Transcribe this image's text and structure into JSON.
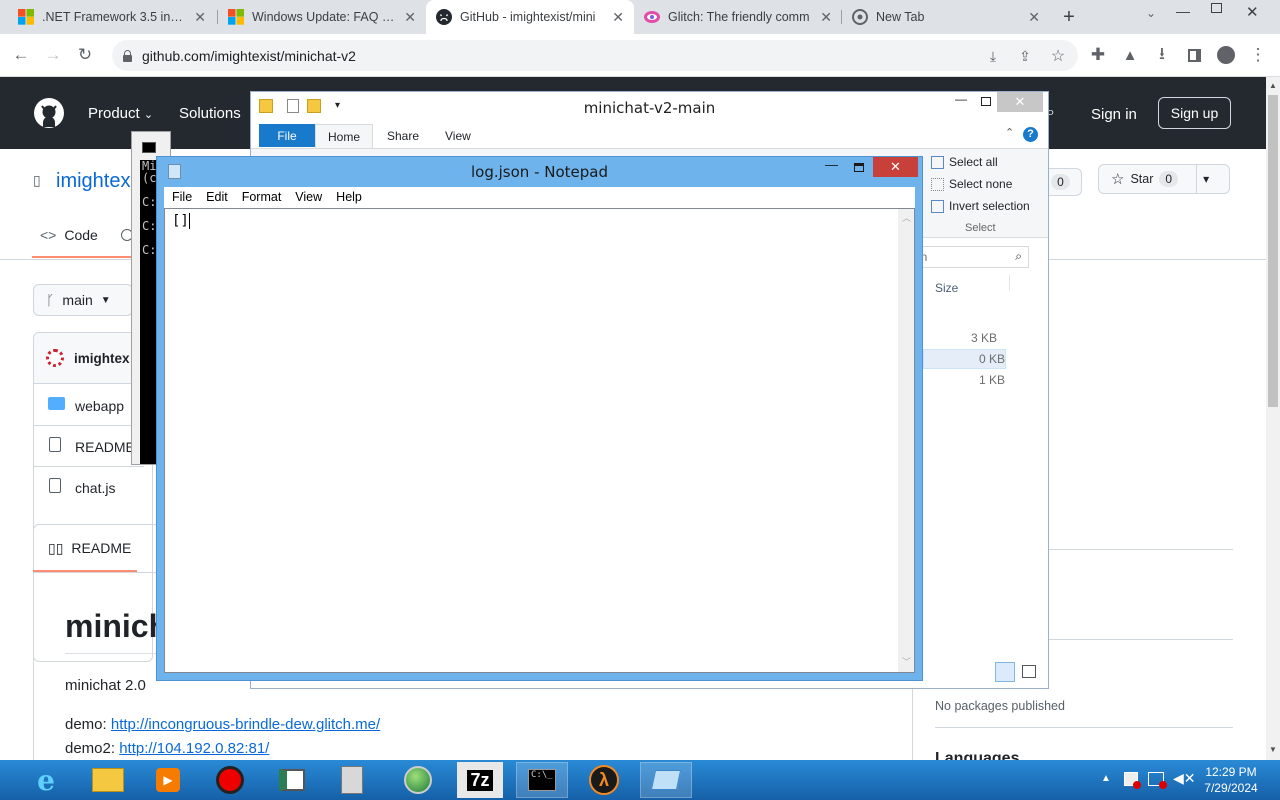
{
  "browser": {
    "tabs": [
      {
        "title": ".NET Framework 3.5 install"
      },
      {
        "title": "Windows Update: FAQ - M"
      },
      {
        "title": "GitHub - imightexist/mini"
      },
      {
        "title": "Glitch: The friendly comm"
      },
      {
        "title": "New Tab"
      }
    ],
    "url": "github.com/imightexist/minichat-v2"
  },
  "github": {
    "nav": [
      "Product",
      "Solutions"
    ],
    "sign_in": "Sign in",
    "sign_up": "Sign up",
    "repo_owner_partial": "imightex",
    "watch_count": "0",
    "star_label": "Star",
    "star_count": "0",
    "code_tab": "Code",
    "branch": "main",
    "commit_author_partial": "imightex",
    "files": [
      "webapp",
      "README",
      "chat.js"
    ],
    "readme_tab": "README",
    "readme_title_partial": "minich",
    "readme_subtitle": "minichat 2.0",
    "demo_label": "demo:",
    "demo_link": "http://incongruous-brindle-dew.glitch.me/",
    "demo2_label": "demo2:",
    "demo2_link": "http://104.192.0.82:81/",
    "packages": "No packages published",
    "languages_partial": "Languages"
  },
  "explorer": {
    "title": "minichat-v2-main",
    "ribbon_tabs": [
      "File",
      "Home",
      "Share",
      "View"
    ],
    "select_all": "Select all",
    "select_none": "Select none",
    "invert_selection": "Invert selection",
    "select_group": "Select",
    "search_partial": "in",
    "size_header": "Size",
    "sizes": [
      "3 KB",
      "0 KB",
      "1 KB"
    ]
  },
  "cmd": {
    "lines": [
      "Mi",
      "(c",
      "C:",
      "C:",
      "C:"
    ]
  },
  "notepad": {
    "title": "log.json - Notepad",
    "menu": [
      "File",
      "Edit",
      "Format",
      "View",
      "Help"
    ],
    "content": "[]"
  },
  "taskbar": {
    "time": "12:29 PM",
    "date": "7/29/2024"
  }
}
